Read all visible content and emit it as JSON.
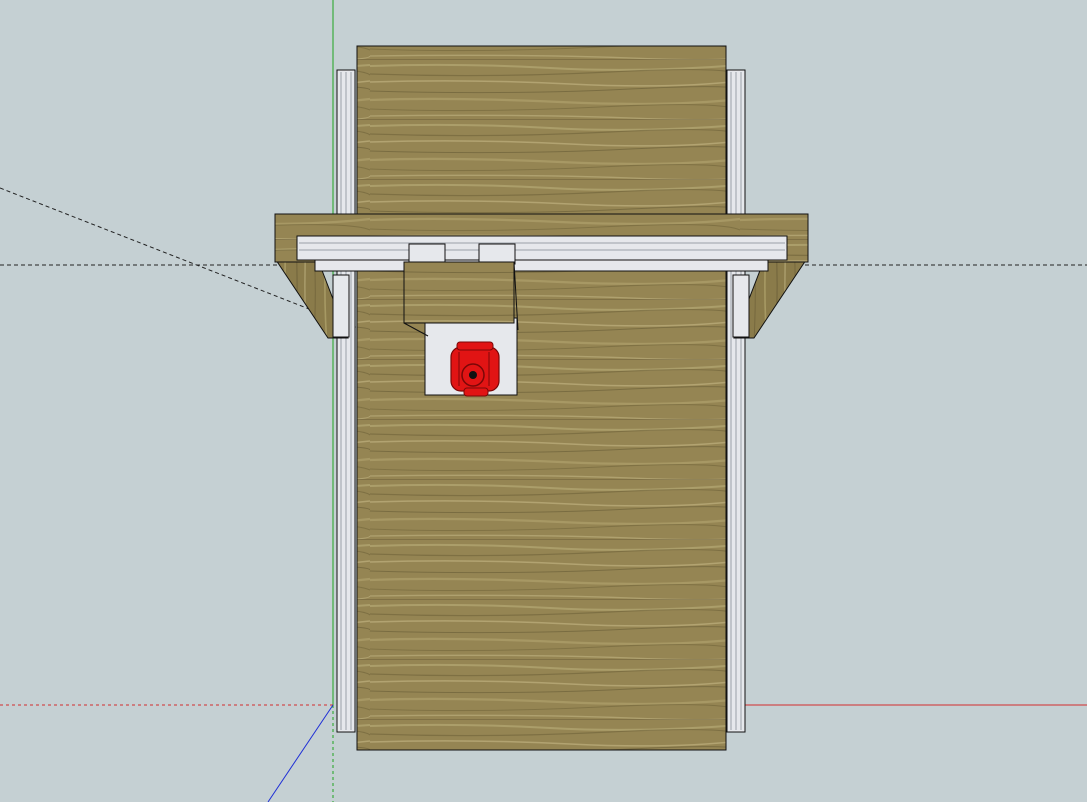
{
  "viewport": {
    "background": "#c5d0d3",
    "view": "top",
    "axis_colors": {
      "red": "#d32c2c",
      "green": "#1fa51f",
      "blue": "#1f2fd6",
      "inference": "#222222"
    }
  },
  "model": {
    "wood_color": "#958553",
    "wood_dark": "#6b5f36",
    "wood_light": "#b6a873",
    "rail_color": "#e6e8ec",
    "rail_shadow": "#9aa0a8",
    "router_color": "#e11414",
    "router_dark": "#7a0707",
    "edge_color": "#111111"
  }
}
